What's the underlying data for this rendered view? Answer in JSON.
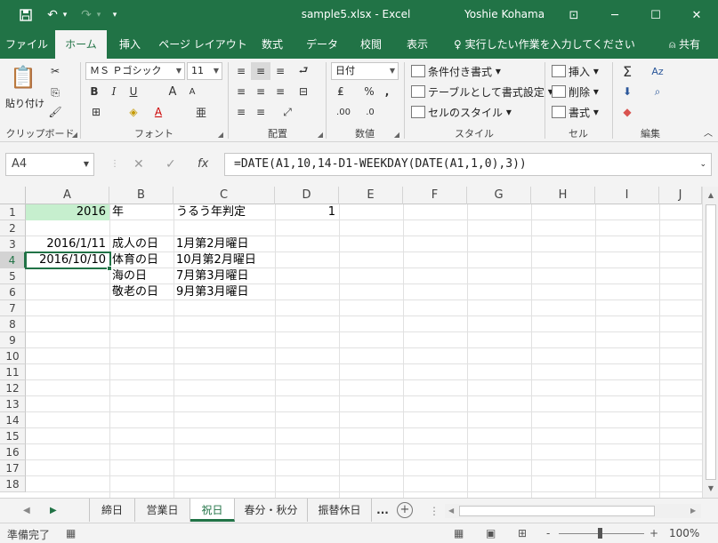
{
  "titlebar": {
    "doc_title": "sample5.xlsx - Excel",
    "user": "Yoshie Kohama",
    "save_icon": "💾",
    "undo_icon": "↶",
    "undo_dd": "▾",
    "redo_icon": "↷",
    "redo_dd": "▾",
    "qat_icon": "▾",
    "ribbon_display_icon": "⊡",
    "minimize": "─",
    "maximize": "☐",
    "close": "✕"
  },
  "ribbon_tabs": [
    "ファイル",
    "ホーム",
    "挿入",
    "ページ レイアウト",
    "数式",
    "データ",
    "校閲",
    "表示"
  ],
  "tell_me": "♀ 実行したい作業を入力してください",
  "share": "⍝ 共有",
  "ribbon": {
    "clipboard": {
      "label": "クリップボード",
      "paste": "貼り付け",
      "paste_icon": "📋",
      "cut_icon": "✂",
      "copy_icon": "⎘",
      "format_painter_icon": "🖌"
    },
    "font": {
      "label": "フォント",
      "font_name": "ＭＳ Ｐゴシック",
      "font_size": "11",
      "bold": "B",
      "italic": "I",
      "underline": "U",
      "grow": "A",
      "shrink": "A",
      "border_icon": "⊞",
      "fill_icon": "◈",
      "font_color": "A",
      "phonetic": "亜"
    },
    "alignment": {
      "label": "配置",
      "icons": [
        "≡",
        "≡",
        "≡",
        "⮐",
        "≡",
        "≡",
        "≡",
        "⊟",
        "≡",
        "≡",
        "⤢"
      ]
    },
    "number": {
      "label": "数値",
      "format": "日付",
      "currency": "₤",
      "percent": "%",
      "comma": ",",
      "inc_decimal": ".00",
      "dec_decimal": ".0"
    },
    "styles": {
      "label": "スタイル",
      "conditional": "条件付き書式",
      "table": "テーブルとして書式設定",
      "cell_styles": "セルのスタイル"
    },
    "cells": {
      "label": "セル",
      "insert": "挿入",
      "delete": "削除",
      "format": "書式"
    },
    "editing": {
      "label": "編集",
      "autosum": "Σ",
      "sort": "Aᴢ",
      "fill": "⬇",
      "find": "⌕",
      "clear": "◆"
    }
  },
  "formula_bar": {
    "name_box": "A4",
    "cancel": "✕",
    "enter": "✓",
    "fx": "fx",
    "formula": "=DATE(A1,10,14-D1-WEEKDAY(DATE(A1,1,0),3))"
  },
  "columns": [
    "A",
    "B",
    "C",
    "D",
    "E",
    "F",
    "G",
    "H",
    "I",
    "J"
  ],
  "rows": [
    "1",
    "2",
    "3",
    "4",
    "5",
    "6",
    "7",
    "8",
    "9",
    "10",
    "11",
    "12",
    "13",
    "14",
    "15",
    "16",
    "17",
    "18"
  ],
  "cells": {
    "A1": "2016",
    "B1": "年",
    "C1": "うるう年判定",
    "D1": "1",
    "A3": "2016/1/11",
    "B3": "成人の日",
    "C3": "1月第2月曜日",
    "A4": "2016/10/10",
    "B4": "体育の日",
    "C4": "10月第2月曜日",
    "B5": "海の日",
    "C5": "7月第3月曜日",
    "B6": "敬老の日",
    "C6": "9月第3月曜日"
  },
  "colors": {
    "accent": "#217346",
    "highlight_fill": "#c6efce"
  },
  "sheets": [
    "締日",
    "営業日",
    "祝日",
    "春分・秋分",
    "振替休日"
  ],
  "active_sheet": "祝日",
  "sheet_more": "...",
  "statusbar": {
    "status": "準備完了",
    "zoom": "100%",
    "zoom_minus": "-",
    "zoom_plus": "+"
  }
}
